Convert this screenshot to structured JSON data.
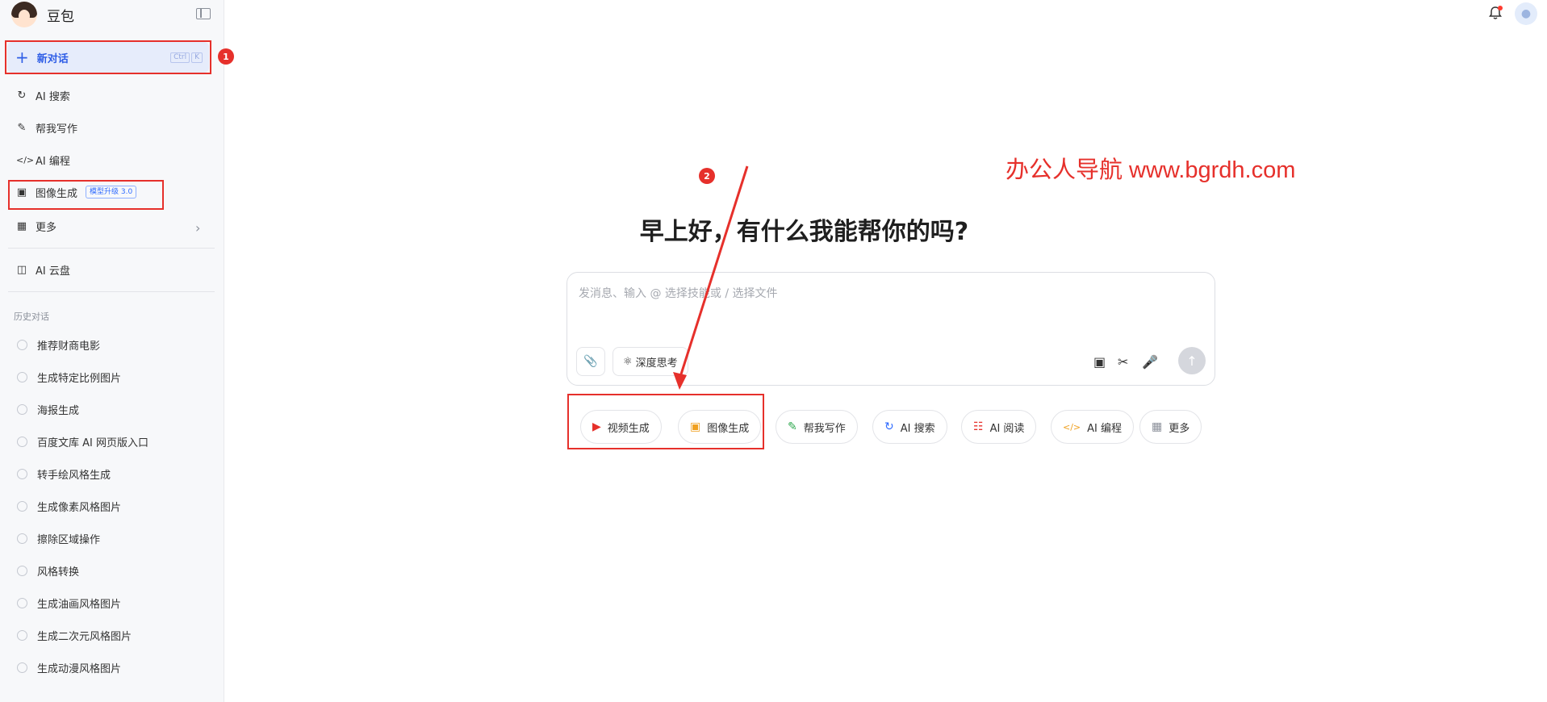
{
  "brand": {
    "name": "豆包"
  },
  "sidebar": {
    "new_chat": {
      "label": "新对话",
      "shortcut": [
        "Ctrl",
        "K"
      ]
    },
    "items": [
      {
        "icon": "search-icon",
        "label": "AI 搜索"
      },
      {
        "icon": "pen-icon",
        "label": "帮我写作"
      },
      {
        "icon": "code-icon",
        "label": "AI 编程"
      },
      {
        "icon": "image-icon",
        "label": "图像生成",
        "badge": "模型升级 3.0"
      },
      {
        "icon": "grid-icon",
        "label": "更多"
      },
      {
        "icon": "cloud-drive-icon",
        "label": "AI 云盘"
      }
    ],
    "history_title": "历史对话",
    "history": [
      "推荐财商电影",
      "生成特定比例图片",
      "海报生成",
      "百度文库 AI 网页版入口",
      "转手绘风格生成",
      "生成像素风格图片",
      "擦除区域操作",
      "风格转换",
      "生成油画风格图片",
      "生成二次元风格图片",
      "生成动漫风格图片"
    ]
  },
  "annotations": {
    "marker1": "1",
    "marker2": "2"
  },
  "watermark": "办公人导航 www.bgrdh.com",
  "main": {
    "greeting": "早上好，有什么我能帮你的吗?",
    "input_placeholder": "发消息、输入 @ 选择技能或 / 选择文件",
    "deep_think": "深度思考",
    "chips": [
      {
        "icon": "video-icon",
        "label": "视频生成",
        "color": "#e6302b"
      },
      {
        "icon": "image-icon",
        "label": "图像生成",
        "color": "#f0a020"
      },
      {
        "icon": "pen-icon",
        "label": "帮我写作",
        "color": "#2fa84f"
      },
      {
        "icon": "search-icon",
        "label": "AI 搜索",
        "color": "#2f6bff"
      },
      {
        "icon": "book-icon",
        "label": "AI 阅读",
        "color": "#e6302b"
      },
      {
        "icon": "code-icon",
        "label": "AI 编程",
        "color": "#f0a020"
      },
      {
        "icon": "grid-icon",
        "label": "更多",
        "color": "#8a8f99"
      }
    ]
  },
  "colors": {
    "accent": "#2f5ee6",
    "annotation": "#e6302b",
    "sidebar_bg": "#f7f8fa"
  }
}
